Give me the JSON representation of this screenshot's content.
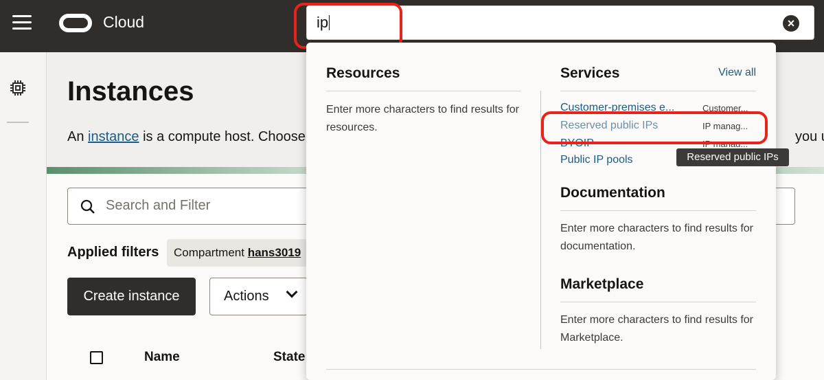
{
  "header": {
    "brand": "Cloud",
    "search_value": "ip"
  },
  "page": {
    "title": "Instances",
    "intro_prefix": "An ",
    "intro_link": "instance",
    "intro_suffix": " is a compute host. Choose",
    "intro_tail": "you use"
  },
  "toolbar": {
    "filter_placeholder": "Search and Filter",
    "applied_filters_label": "Applied filters",
    "chip_label": "Compartment ",
    "chip_value": "hans3019",
    "create_label": "Create instance",
    "actions_label": "Actions"
  },
  "table": {
    "columns": [
      "Name",
      "State"
    ]
  },
  "dropdown": {
    "resources_title": "Resources",
    "resources_msg": "Enter more characters to find results for resources.",
    "services_title": "Services",
    "view_all": "View all",
    "services": [
      {
        "name": "Customer-premises e...",
        "category": "Customer..."
      },
      {
        "name": "Reserved public IPs",
        "category": "IP manag..."
      },
      {
        "name": "BYOIP",
        "category": "IP manag..."
      },
      {
        "name": "Public IP pools",
        "category": "IP manag..."
      }
    ],
    "documentation_title": "Documentation",
    "documentation_msg": "Enter more characters to find results for documentation.",
    "marketplace_title": "Marketplace",
    "marketplace_msg": "Enter more characters to find results for Marketplace.",
    "tooltip": "Reserved public IPs"
  },
  "colors": {
    "topbar": "#312d2a",
    "link": "#1a5c86",
    "annotation": "#e8231a"
  }
}
